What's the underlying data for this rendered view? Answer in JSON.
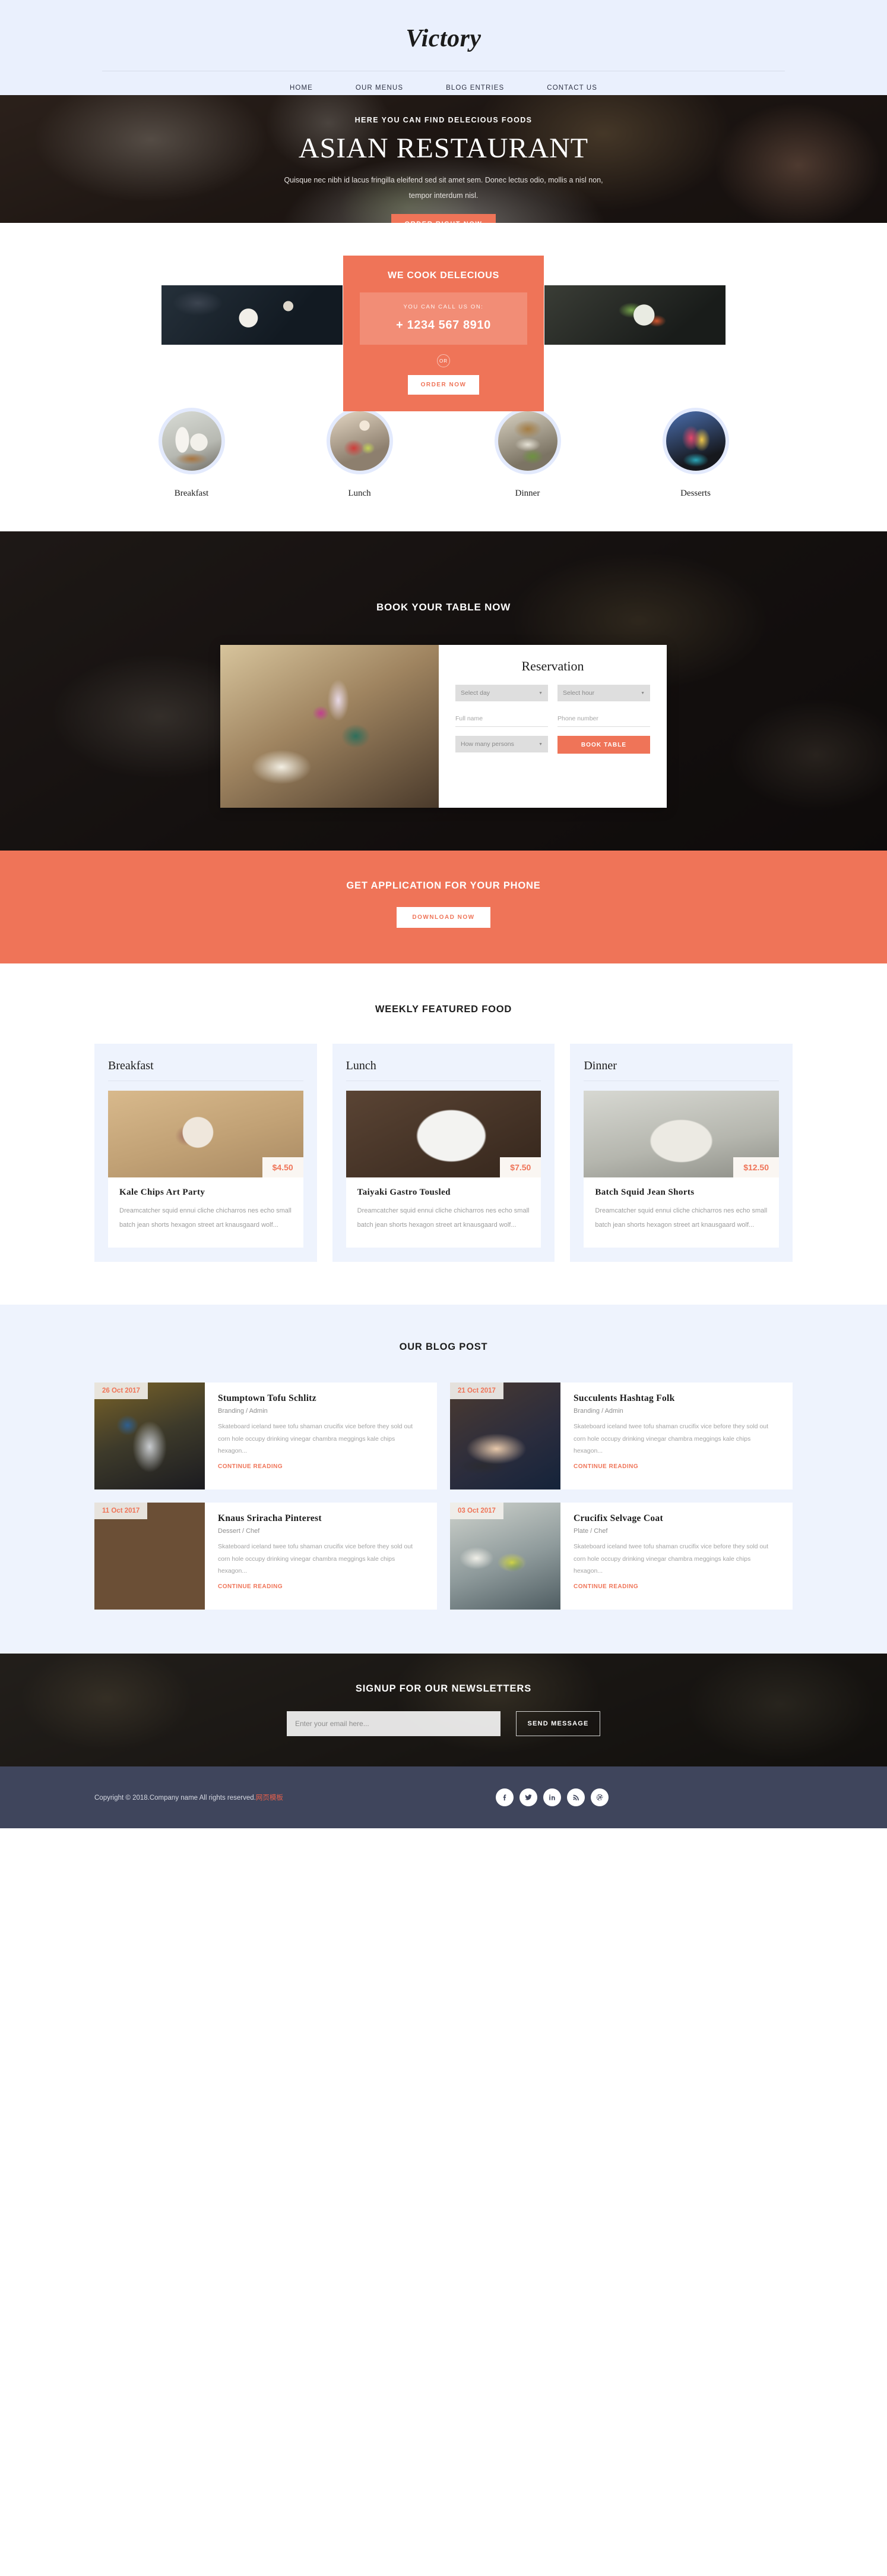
{
  "header": {
    "brand": "Victory",
    "nav": [
      {
        "label": "HOME"
      },
      {
        "label": "OUR MENUS"
      },
      {
        "label": "BLOG ENTRIES"
      },
      {
        "label": "CONTACT US"
      }
    ]
  },
  "hero": {
    "eyebrow": "HERE YOU CAN FIND DELECIOUS FOODS",
    "title": "ASIAN RESTAURANT",
    "subtitle": "Quisque nec nibh id lacus fringilla eleifend sed sit amet sem. Donec lectus odio, mollis a nisl non, tempor interdum nisl.",
    "cta": "ORDER RIGHT NOW"
  },
  "cook": {
    "title": "WE COOK DELECIOUS",
    "call_label": "YOU CAN CALL US ON:",
    "phone": "+ 1234 567 8910",
    "or": "OR",
    "cta": "ORDER NOW"
  },
  "categories": [
    {
      "label": "Breakfast",
      "img": "breakfast"
    },
    {
      "label": "Lunch",
      "img": "lunch"
    },
    {
      "label": "Dinner",
      "img": "dinner"
    },
    {
      "label": "Desserts",
      "img": "desserts"
    }
  ],
  "booking": {
    "section_title": "BOOK YOUR TABLE NOW",
    "form_title": "Reservation",
    "select_day": "Select day",
    "select_hour": "Select hour",
    "full_name_placeholder": "Full name",
    "phone_placeholder": "Phone number",
    "persons": "How many persons",
    "submit": "BOOK TABLE"
  },
  "app_banner": {
    "title": "GET APPLICATION FOR YOUR PHONE",
    "cta": "DOWNLOAD NOW"
  },
  "featured": {
    "title": "WEEKLY FEATURED FOOD",
    "columns": [
      {
        "heading": "Breakfast",
        "price": "$4.50",
        "name": "Kale Chips Art Party",
        "desc": "Dreamcatcher squid ennui cliche chicharros nes echo small batch jean shorts hexagon street art knausgaard wolf..."
      },
      {
        "heading": "Lunch",
        "price": "$7.50",
        "name": "Taiyaki Gastro Tousled",
        "desc": "Dreamcatcher squid ennui cliche chicharros nes echo small batch jean shorts hexagon street art knausgaard wolf..."
      },
      {
        "heading": "Dinner",
        "price": "$12.50",
        "name": "Batch Squid Jean Shorts",
        "desc": "Dreamcatcher squid ennui cliche chicharros nes echo small batch jean shorts hexagon street art knausgaard wolf..."
      }
    ]
  },
  "blog": {
    "title": "OUR BLOG POST",
    "read_more": "CONTINUE READING",
    "posts": [
      {
        "date": "26 Oct 2017",
        "title": "Stumptown Tofu Schlitz",
        "meta": "Branding / Admin",
        "excerpt": "Skateboard iceland twee tofu shaman crucifix vice before they sold out corn hole occupy drinking vinegar chambra meggings kale chips hexagon..."
      },
      {
        "date": "21 Oct 2017",
        "title": "Succulents Hashtag Folk",
        "meta": "Branding / Admin",
        "excerpt": "Skateboard iceland twee tofu shaman crucifix vice before they sold out corn hole occupy drinking vinegar chambra meggings kale chips hexagon..."
      },
      {
        "date": "11 Oct 2017",
        "title": "Knaus Sriracha Pinterest",
        "meta": "Dessert / Chef",
        "excerpt": "Skateboard iceland twee tofu shaman crucifix vice before they sold out corn hole occupy drinking vinegar chambra meggings kale chips hexagon..."
      },
      {
        "date": "03 Oct 2017",
        "title": "Crucifix Selvage Coat",
        "meta": "Plate / Chef",
        "excerpt": "Skateboard iceland twee tofu shaman crucifix vice before they sold out corn hole occupy drinking vinegar chambra meggings kale chips hexagon..."
      }
    ]
  },
  "newsletter": {
    "title": "SIGNUP FOR OUR NEWSLETTERS",
    "placeholder": "Enter your email here...",
    "submit": "SEND MESSAGE"
  },
  "footer": {
    "copyright": "Copyright © 2018.Company name All rights reserved.",
    "credit": "网页模板",
    "socials": [
      {
        "name": "facebook-icon"
      },
      {
        "name": "twitter-icon"
      },
      {
        "name": "linkedin-icon"
      },
      {
        "name": "rss-icon"
      },
      {
        "name": "dribbble-icon"
      }
    ]
  },
  "colors": {
    "accent": "#ef7458",
    "header_bg": "#eaf0fd",
    "panel_bg": "#eef3fd",
    "footer_bg": "#3f455c"
  }
}
